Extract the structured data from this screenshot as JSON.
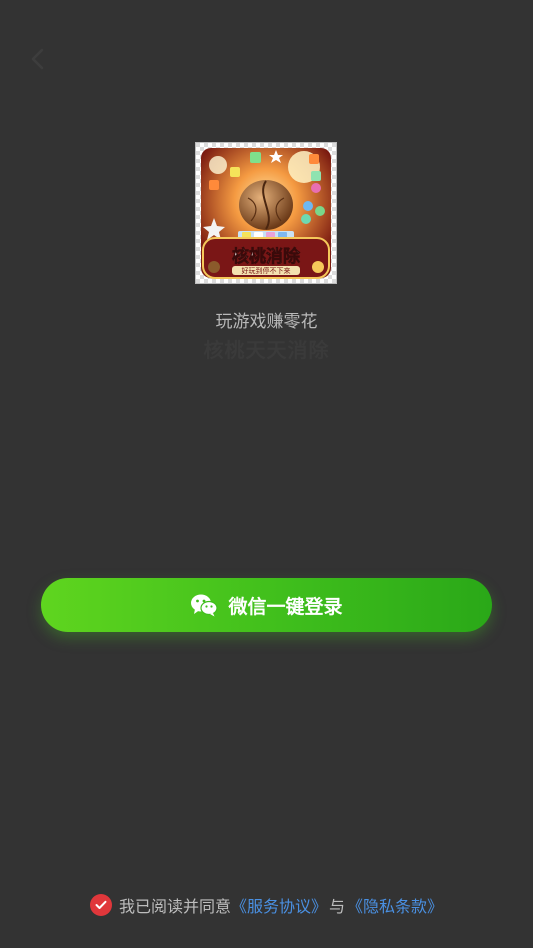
{
  "header": {
    "back_icon": "chevron-left-icon"
  },
  "app": {
    "icon_title": "核桃消除",
    "icon_subtitle": "好玩到停不下来",
    "tagline": "玩游戏赚零花",
    "subtitle": "核桃天天消除"
  },
  "login": {
    "wechat_label": "微信一键登录",
    "icon": "wechat-icon",
    "color": "#3fbe1c"
  },
  "agreement": {
    "prefix": "我已阅读并同意",
    "service_link": "《服务协议》",
    "conjunction": "与",
    "privacy_link": "《隐私条款》",
    "check_color": "#e0373b"
  }
}
